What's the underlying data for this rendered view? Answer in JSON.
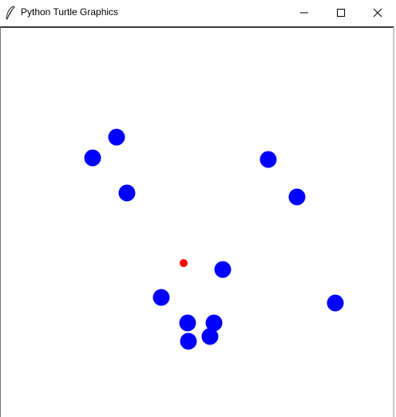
{
  "window": {
    "title": "Python Turtle Graphics",
    "controls": {
      "minimize_icon": "minimize-icon",
      "maximize_icon": "maximize-icon",
      "close_icon": "close-icon"
    },
    "app_icon": "feather-icon"
  },
  "canvas": {
    "background": "#ffffff",
    "turtle_color": "#0000ff",
    "pen_color": "#ff0000"
  }
}
